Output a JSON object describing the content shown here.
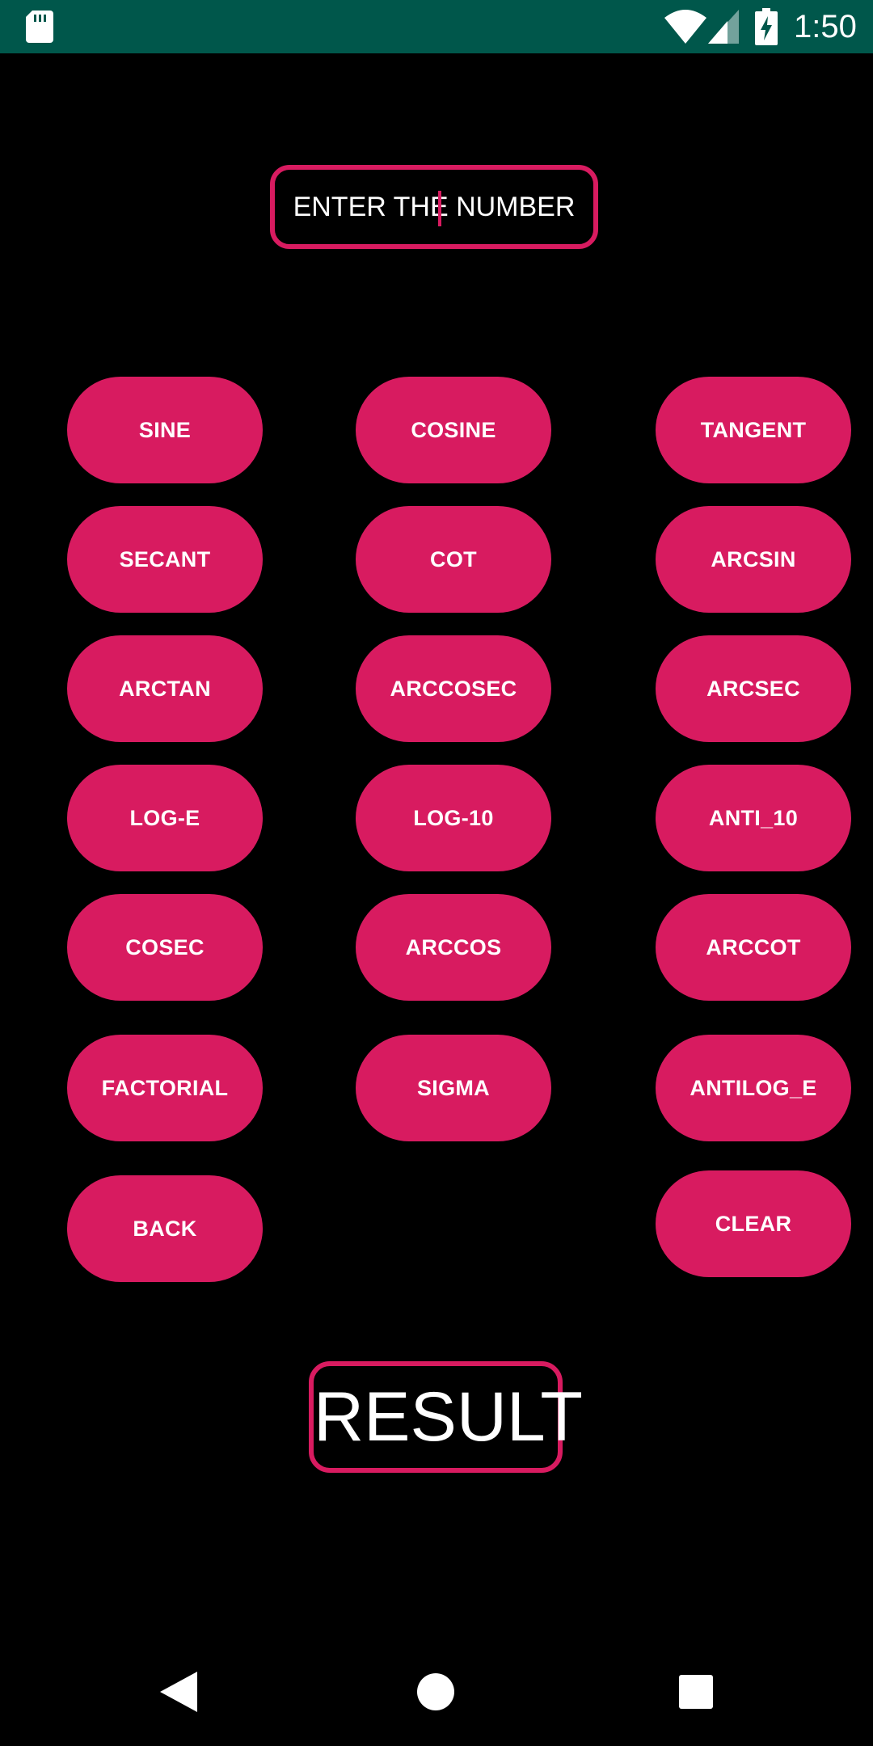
{
  "status_bar": {
    "time": "1:50",
    "icons": [
      "sd-card-icon",
      "wifi-icon",
      "cell-signal-icon",
      "battery-charging-icon"
    ],
    "background": "#00574b"
  },
  "input": {
    "placeholder": "ENTER THE NUMBER",
    "value": ""
  },
  "buttons": {
    "sine": "SINE",
    "cosine": "COSINE",
    "tangent": "TANGENT",
    "secant": "SECANT",
    "cot": "COT",
    "arcsin": "ARCSIN",
    "arctan": "ARCTAN",
    "arccosec": "ARCCOSEC",
    "arcsec": "ARCSEC",
    "log_e": "LOG-E",
    "log_10": "LOG-10",
    "anti_10": "ANTI_10",
    "cosec": "COSEC",
    "arccos": "ARCCOS",
    "arccot": "ARCCOT",
    "factorial": "FACTORIAL",
    "sigma": "SIGMA",
    "antilog_e": "ANTILOG_E",
    "back": "BACK",
    "clear": "CLEAR"
  },
  "result": {
    "label": "RESULT"
  },
  "nav_bar": {
    "icons": [
      "back-triangle-icon",
      "home-circle-icon",
      "recents-square-icon"
    ]
  },
  "colors": {
    "accent": "#d81b60",
    "background": "#000000",
    "status_bar": "#00574b",
    "text": "#ffffff"
  }
}
